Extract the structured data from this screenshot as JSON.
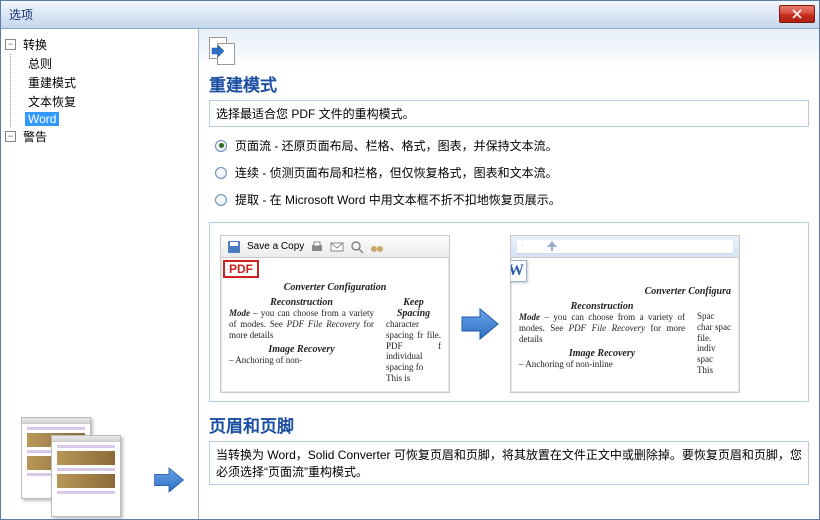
{
  "window": {
    "title": "选项"
  },
  "tree": {
    "root": {
      "label": "转换",
      "children": [
        {
          "label": "总则"
        },
        {
          "label": "重建模式"
        },
        {
          "label": "文本恢复"
        },
        {
          "label": "Word",
          "selected": true
        }
      ]
    },
    "second": {
      "label": "警告"
    }
  },
  "main": {
    "section1_title": "重建模式",
    "section1_desc": "选择最适合您 PDF 文件的重构模式。",
    "radios": [
      {
        "label": "页面流 - 还原页面布局、栏格、格式，图表，并保持文本流。",
        "checked": true
      },
      {
        "label": "连续 - 侦测页面布局和栏格，但仅恢复格式，图表和文本流。",
        "checked": false
      },
      {
        "label": "提取 - 在 Microsoft Word 中用文本框不折不扣地恢复页展示。",
        "checked": false
      }
    ],
    "preview": {
      "saveCopy": "Save a Copy",
      "pdfBadge": "PDF",
      "wBadge": "W",
      "heading": "Converter Configuration",
      "leftCol": {
        "h1": "Reconstruction",
        "p1": "Mode – you can choose from a variety of modes. See PDF File Recovery for more details",
        "h2": "Image Recovery",
        "p2": "– Anchoring of non-"
      },
      "rightCol": {
        "h1": "Keep Spacing",
        "p1": "character spacing fr file. PDF f individual spacing fo",
        "p2": "This is"
      },
      "right2": {
        "h1": "Reconstruction",
        "p1": "Mode – you can choose from a variety of modes. See PDF File Recovery for more details",
        "h2": "Image Recovery",
        "p2": "– Anchoring of non-inline",
        "sp1": "Spac char spac file. indiv spac",
        "sp2": "This"
      },
      "heading2": "Converter Configura"
    },
    "section2_title": "页眉和页脚",
    "section2_desc": "当转换为 Word，Solid Converter 可恢复页眉和页脚，将其放置在文件正文中或删除掉。要恢复页眉和页脚，您必须选择“页面流”重构模式。"
  }
}
